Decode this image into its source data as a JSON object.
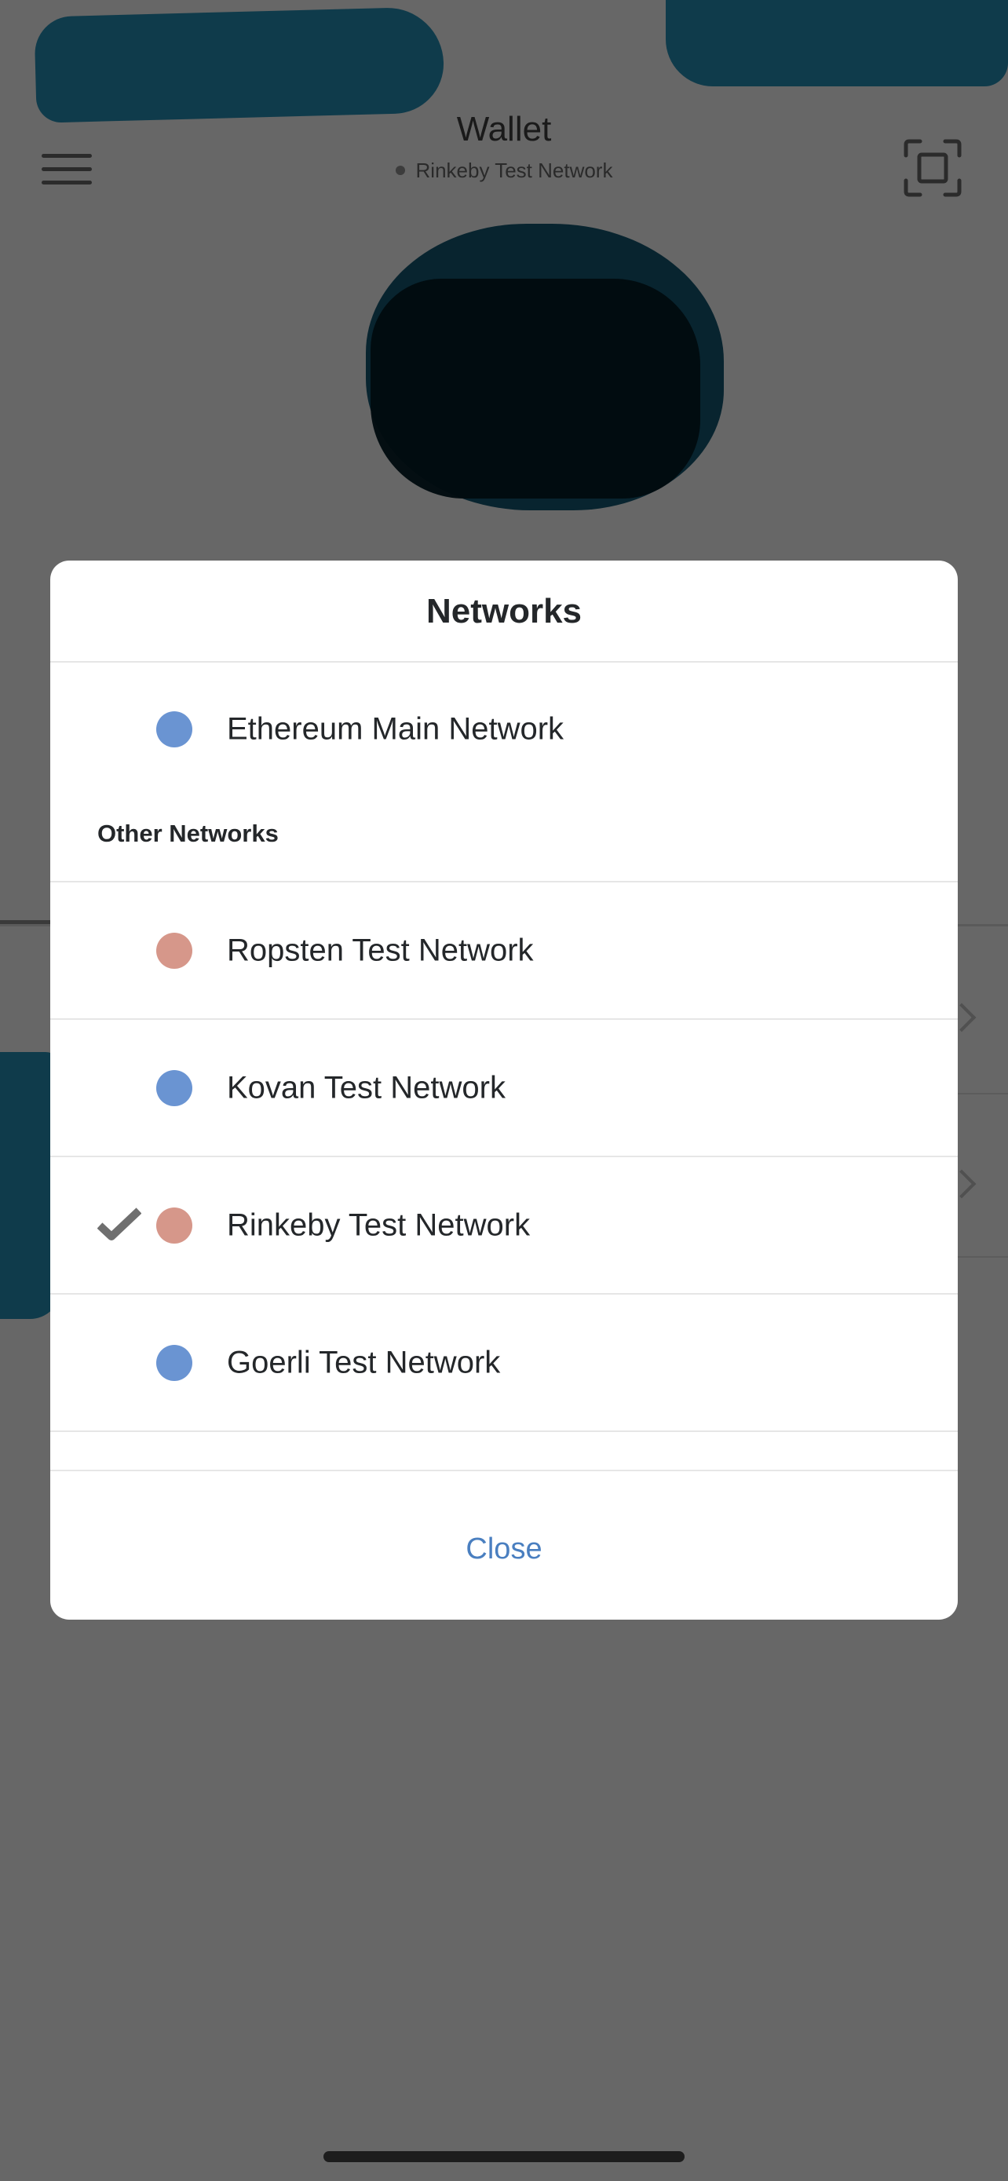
{
  "header": {
    "title": "Wallet",
    "network_label": "Rinkeby Test Network"
  },
  "modal": {
    "title": "Networks",
    "main_network": {
      "name": "Ethereum Main Network",
      "color": "#6a94d2"
    },
    "other_networks_heading": "Other Networks",
    "other_networks": [
      {
        "name": "Ropsten Test Network",
        "color": "#d6978a",
        "selected": false
      },
      {
        "name": "Kovan Test Network",
        "color": "#6a94d2",
        "selected": false
      },
      {
        "name": "Rinkeby Test Network",
        "color": "#d6978a",
        "selected": true
      },
      {
        "name": "Goerli Test Network",
        "color": "#6a94d2",
        "selected": false
      }
    ],
    "close_label": "Close"
  },
  "colors": {
    "overlay": "#676767",
    "accent": "#4a7fc0",
    "check": "#6f6f6f"
  }
}
